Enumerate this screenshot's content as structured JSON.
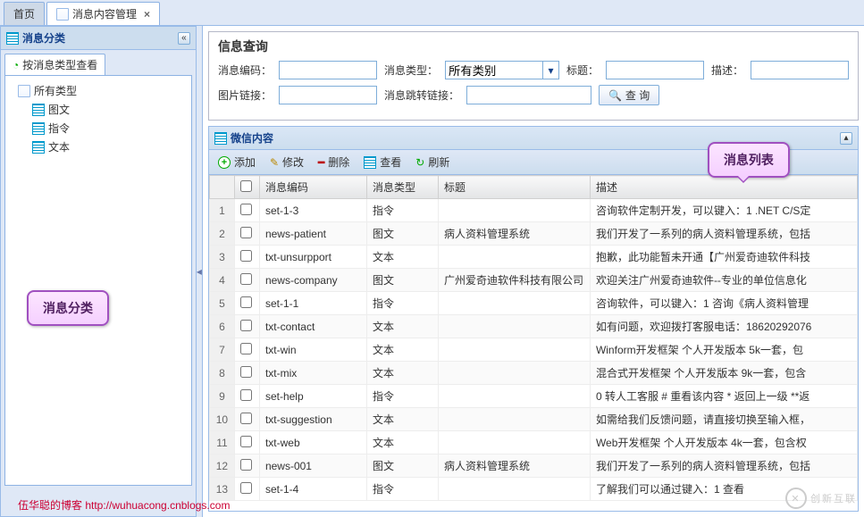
{
  "tabs": {
    "home": "首页",
    "manage": "消息内容管理"
  },
  "left": {
    "title": "消息分类",
    "subtab": "按消息类型查看",
    "tree": {
      "all": "所有类型",
      "imgtxt": "图文",
      "cmd": "指令",
      "text": "文本"
    }
  },
  "query": {
    "legend": "信息查询",
    "code": "消息编码：",
    "type": "消息类型：",
    "type_value": "所有类别",
    "title": "标题：",
    "desc": "描述：",
    "imglink": "图片链接：",
    "jumplink": "消息跳转链接：",
    "search": "查 询"
  },
  "grid": {
    "title": "微信内容",
    "toolbar": {
      "add": "添加",
      "edit": "修改",
      "del": "删除",
      "view": "查看",
      "refresh": "刷新"
    },
    "cols": {
      "code": "消息编码",
      "type": "消息类型",
      "title": "标题",
      "desc": "描述"
    },
    "rows": [
      {
        "n": 1,
        "code": "set-1-3",
        "type": "指令",
        "title": "",
        "desc": "咨询软件定制开发，可以键入：1 .NET C/S定"
      },
      {
        "n": 2,
        "code": "news-patient",
        "type": "图文",
        "title": "病人资料管理系统",
        "desc": "我们开发了一系列的病人资料管理系统，包括"
      },
      {
        "n": 3,
        "code": "txt-unsurpport",
        "type": "文本",
        "title": "",
        "desc": "抱歉，此功能暂未开通【广州爱奇迪软件科技"
      },
      {
        "n": 4,
        "code": "news-company",
        "type": "图文",
        "title": "广州爱奇迪软件科技有限公司",
        "desc": "欢迎关注广州爱奇迪软件--专业的单位信息化"
      },
      {
        "n": 5,
        "code": "set-1-1",
        "type": "指令",
        "title": "",
        "desc": "咨询软件，可以键入：1 咨询《病人资料管理"
      },
      {
        "n": 6,
        "code": "txt-contact",
        "type": "文本",
        "title": "",
        "desc": "如有问题，欢迎拨打客服电话：18620292076"
      },
      {
        "n": 7,
        "code": "txt-win",
        "type": "文本",
        "title": "",
        "desc": "Winform开发框架 个人开发版本 5k一套，包"
      },
      {
        "n": 8,
        "code": "txt-mix",
        "type": "文本",
        "title": "",
        "desc": "混合式开发框架 个人开发版本 9k一套，包含"
      },
      {
        "n": 9,
        "code": "set-help",
        "type": "指令",
        "title": "",
        "desc": "0 转人工客服 # 重看该内容 * 返回上一级 **返"
      },
      {
        "n": 10,
        "code": "txt-suggestion",
        "type": "文本",
        "title": "",
        "desc": "如需给我们反馈问题，请直接切换至输入框，"
      },
      {
        "n": 11,
        "code": "txt-web",
        "type": "文本",
        "title": "",
        "desc": "Web开发框架 个人开发版本 4k一套，包含权"
      },
      {
        "n": 12,
        "code": "news-001",
        "type": "图文",
        "title": "病人资料管理系统",
        "desc": "我们开发了一系列的病人资料管理系统，包括"
      },
      {
        "n": 13,
        "code": "set-1-4",
        "type": "指令",
        "title": "",
        "desc": "了解我们可以通过键入：1 查看"
      }
    ]
  },
  "callouts": {
    "c1": "消息分类",
    "c2": "消息列表"
  },
  "footer": "伍华聪的博客 http://wuhuacong.cnblogs.com",
  "watermark": "创新互联"
}
